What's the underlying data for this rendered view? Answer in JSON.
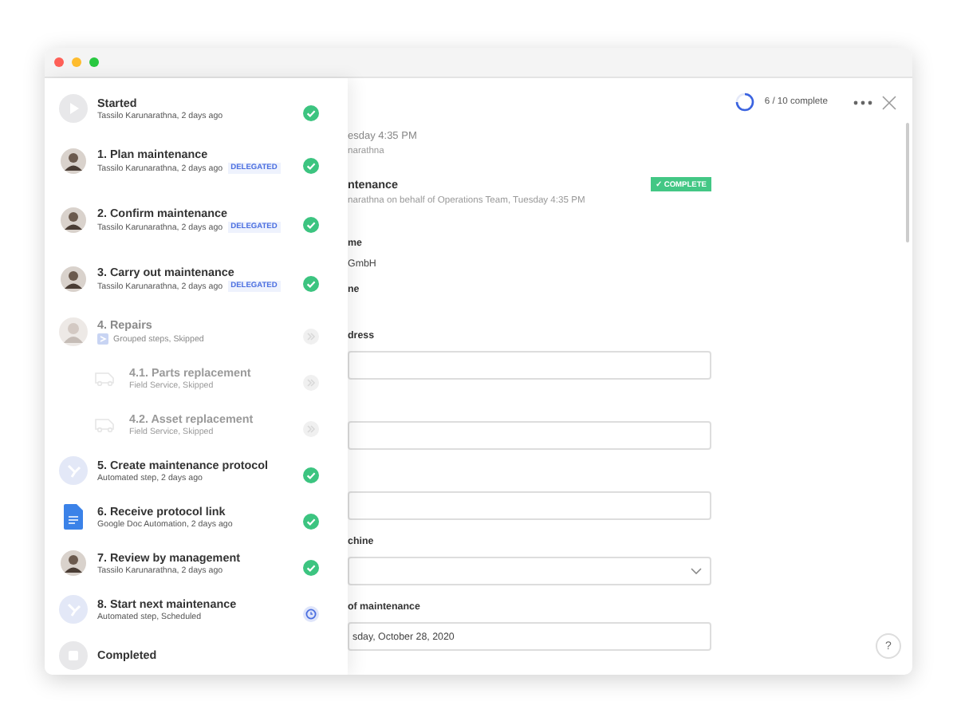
{
  "progress": {
    "label": "6 / 10 complete"
  },
  "steps": [
    {
      "kind": "start",
      "title": "Started",
      "subtitle": "Tassilo Karunarathna, 2 days ago",
      "delegated": false,
      "complete": true,
      "skipped": false
    },
    {
      "kind": "person",
      "title": "1. Plan maintenance",
      "subtitle": "Tassilo Karunarathna, 2 days ago",
      "delegated": true,
      "badge": "DELEGATED",
      "complete": true,
      "skipped": false
    },
    {
      "kind": "person",
      "title": "2. Confirm maintenance",
      "subtitle": "Tassilo Karunarathna, 2 days ago",
      "delegated": true,
      "badge": "DELEGATED",
      "complete": true,
      "skipped": false
    },
    {
      "kind": "person",
      "title": "3. Carry out maintenance",
      "subtitle": "Tassilo Karunarathna, 2 days ago",
      "delegated": true,
      "badge": "DELEGATED",
      "complete": true,
      "skipped": false
    },
    {
      "kind": "group",
      "title": "4. Repairs",
      "subtitle": "Grouped steps, Skipped",
      "delegated": false,
      "complete": false,
      "skipped": true,
      "children": [
        {
          "kind": "field",
          "title": "4.1. Parts replacement",
          "subtitle": "Field Service, Skipped",
          "complete": false,
          "skipped": true
        },
        {
          "kind": "field",
          "title": "4.2. Asset replacement",
          "subtitle": "Field Service, Skipped",
          "complete": false,
          "skipped": true
        }
      ]
    },
    {
      "kind": "automated",
      "title": "5. Create maintenance protocol",
      "subtitle": "Automated step, 2 days ago",
      "delegated": false,
      "complete": true,
      "skipped": false
    },
    {
      "kind": "doc",
      "title": "6. Receive protocol link",
      "subtitle": "Google Doc Automation, 2 days ago",
      "delegated": false,
      "complete": true,
      "skipped": false
    },
    {
      "kind": "person",
      "title": "7. Review by management",
      "subtitle": "Tassilo Karunarathna, 2 days ago",
      "delegated": false,
      "complete": true,
      "skipped": false
    },
    {
      "kind": "automated",
      "title": "8. Start next maintenance",
      "subtitle": "Automated step, Scheduled",
      "delegated": false,
      "complete": false,
      "skipped": false,
      "scheduled": true
    },
    {
      "kind": "end",
      "title": "Completed"
    }
  ],
  "main": {
    "meta": [
      "esday 4:35 PM",
      "narathna"
    ],
    "task_title": "ntenance",
    "badge": "✓ COMPLETE",
    "task_subtitle": "narathna on behalf of Operations Team, Tuesday 4:35 PM",
    "form": [
      {
        "kind": "label",
        "text": "me"
      },
      {
        "kind": "value",
        "text": "GmbH"
      },
      {
        "kind": "label",
        "text": "ne"
      },
      {
        "kind": "gap"
      },
      {
        "kind": "label",
        "text": "dress"
      },
      {
        "kind": "input"
      },
      {
        "kind": "gap"
      },
      {
        "kind": "input"
      },
      {
        "kind": "gap"
      },
      {
        "kind": "input"
      },
      {
        "kind": "label",
        "text": "chine"
      },
      {
        "kind": "select"
      },
      {
        "kind": "label",
        "text": "of maintenance"
      },
      {
        "kind": "input",
        "text": "sday, October 28, 2020"
      }
    ]
  },
  "help": "?"
}
